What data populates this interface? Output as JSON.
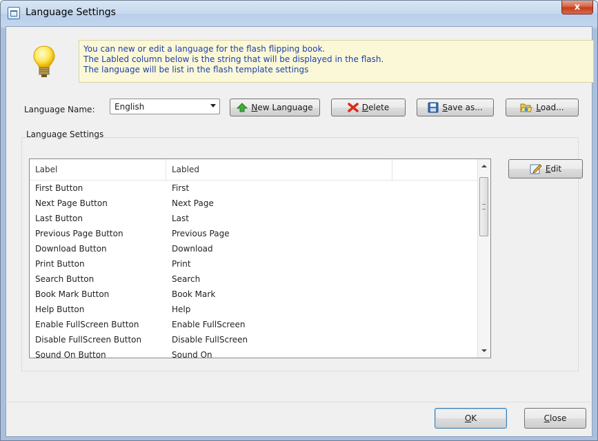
{
  "window": {
    "title": "Language Settings",
    "close_label": "x"
  },
  "info": {
    "lines": [
      "You can new or edit  a language for the flash flipping book.",
      "The Labled column below is the string that will be displayed in the flash.",
      "The language will be list in the flash template settings"
    ]
  },
  "language": {
    "label": "Language Name:",
    "selected": "English"
  },
  "toolbar": {
    "new_language": {
      "access_key": "N",
      "rest": "ew Language"
    },
    "delete": {
      "access_key": "D",
      "rest": "elete"
    },
    "save_as": {
      "access_key": "S",
      "rest": "ave as..."
    },
    "load": {
      "access_key": "L",
      "rest": "oad..."
    }
  },
  "group": {
    "label": "Language Settings"
  },
  "table": {
    "headers": [
      "Label",
      "Labled"
    ],
    "rows": [
      [
        "First Button",
        "First"
      ],
      [
        "Next Page Button",
        "Next Page"
      ],
      [
        "Last Button",
        "Last"
      ],
      [
        "Previous Page Button",
        "Previous Page"
      ],
      [
        "Download Button",
        "Download"
      ],
      [
        "Print Button",
        "Print"
      ],
      [
        "Search Button",
        "Search"
      ],
      [
        "Book Mark Button",
        "Book Mark"
      ],
      [
        "Help Button",
        "Help"
      ],
      [
        "Enable FullScreen Button",
        "Enable FullScreen"
      ],
      [
        "Disable FullScreen Button",
        "Disable FullScreen"
      ],
      [
        "Sound On Button",
        "Sound On"
      ]
    ]
  },
  "edit": {
    "access_key": "E",
    "rest": "dit"
  },
  "footer": {
    "ok": {
      "access_key": "O",
      "rest": "K"
    },
    "close": {
      "access_key": "C",
      "rest": "lose"
    }
  },
  "icons": {
    "bulb": "lightbulb-icon",
    "new_language": "green-arrow-up-icon",
    "delete": "red-x-icon",
    "save_as": "floppy-disk-icon",
    "load": "open-folder-icon",
    "edit": "edit-pencil-icon"
  }
}
